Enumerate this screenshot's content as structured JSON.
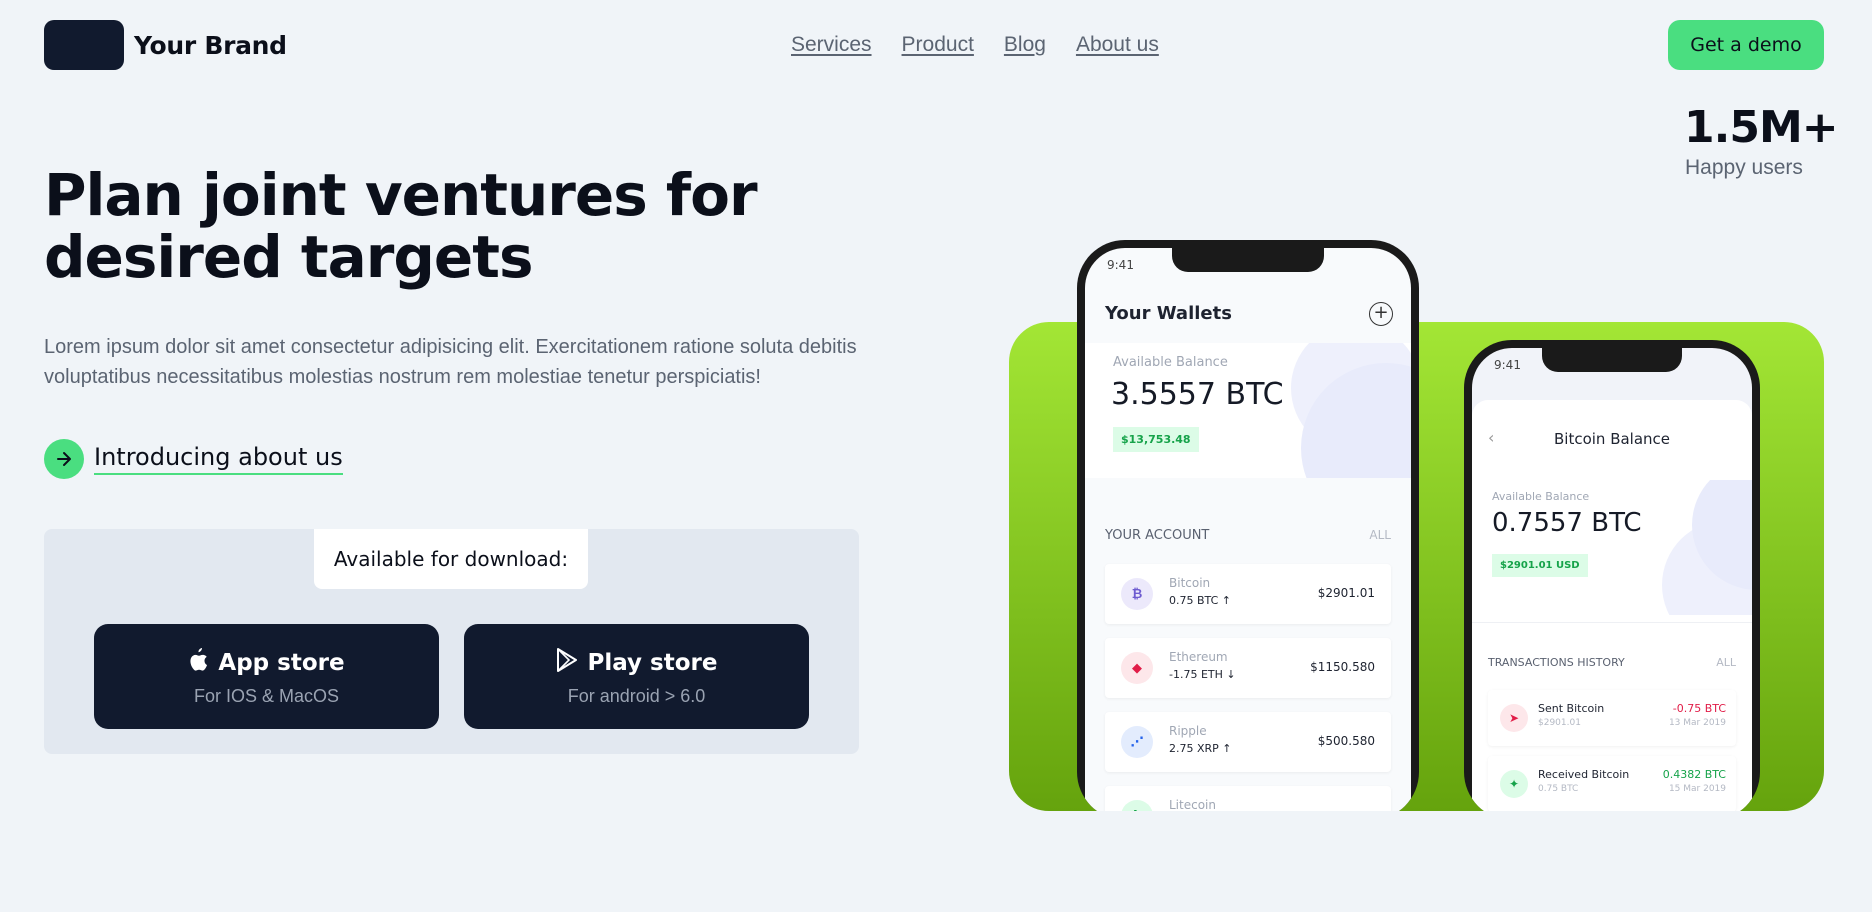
{
  "header": {
    "brand": "Your Brand",
    "nav": [
      "Services",
      "Product",
      "Blog",
      "About us"
    ],
    "cta": "Get a demo"
  },
  "stats": {
    "value": "1.5M+",
    "label": "Happy users"
  },
  "hero": {
    "headline": "Plan joint ventures for desired targets",
    "subtitle": "Lorem ipsum dolor sit amet consectetur adipisicing elit. Exercitationem ratione soluta debitis voluptatibus necessitatibus molestias nostrum rem molestiae tenetur perspiciatis!",
    "intro_link": "Introducing about us"
  },
  "download": {
    "label": "Available for download:",
    "app_store": {
      "title": "App store",
      "sub": "For IOS & MacOS"
    },
    "play_store": {
      "title": "Play store",
      "sub": "For android > 6.0"
    }
  },
  "phone1": {
    "time": "9:41",
    "title": "Your Wallets",
    "balance_label": "Available Balance",
    "balance_value": "3.5557 BTC",
    "balance_usd": "$13,753.48",
    "section": "YOUR ACCOUNT",
    "section_all": "ALL",
    "coins": [
      {
        "name": "Bitcoin",
        "amount": "0.75 BTC ↑",
        "value": "$2901.01"
      },
      {
        "name": "Ethereum",
        "amount": "-1.75 ETH ↓",
        "value": "$1150.580"
      },
      {
        "name": "Ripple",
        "amount": "2.75 XRP ↑",
        "value": "$500.580"
      },
      {
        "name": "Litecoin",
        "amount": "",
        "value": ""
      }
    ]
  },
  "phone2": {
    "time": "9:41",
    "title": "Bitcoin Balance",
    "balance_label": "Available Balance",
    "balance_value": "0.7557 BTC",
    "balance_usd": "$2901.01 USD",
    "section": "TRANSACTIONS HISTORY",
    "section_all": "ALL",
    "transactions": [
      {
        "name": "Sent Bitcoin",
        "sub": "$2901.01",
        "amount": "-0.75 BTC",
        "date": "13 Mar 2019"
      },
      {
        "name": "Received Bitcoin",
        "sub": "0.75 BTC",
        "amount": "0.4382 BTC",
        "date": "15 Mar 2019"
      }
    ]
  },
  "colors": {
    "accent": "#4ade80",
    "dark": "#111a2e",
    "green_top": "#a3e635",
    "green_bottom": "#65a30d"
  }
}
